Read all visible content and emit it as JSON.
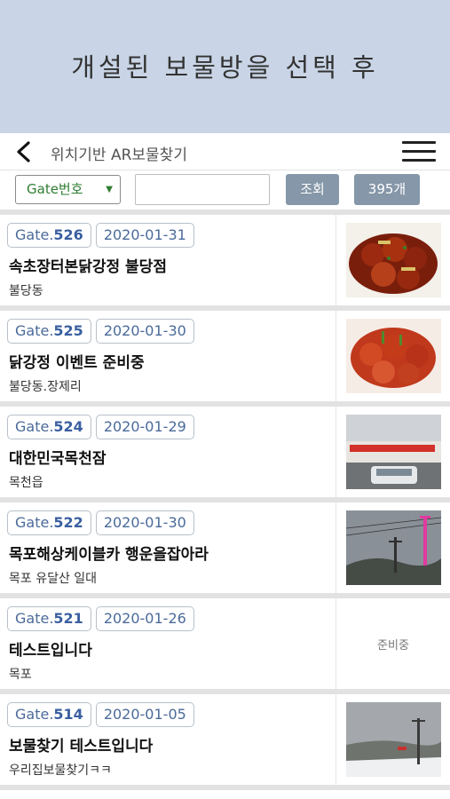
{
  "banner": {
    "text": "개설된 보물방을 선택 후"
  },
  "appbar": {
    "title": "위치기반 AR보물찾기"
  },
  "filter": {
    "select_value": "Gate번호",
    "search_value": "",
    "query_label": "조회",
    "count_label": "395개"
  },
  "items": [
    {
      "gate_prefix": "Gate.",
      "gate_num": "526",
      "date": "2020-01-31",
      "title": "속초장터본닭강정 불당점",
      "location": "불당동",
      "thumb": "food-photo",
      "thumb_text": ""
    },
    {
      "gate_prefix": "Gate.",
      "gate_num": "525",
      "date": "2020-01-30",
      "title": "닭강정 이벤트 준비중",
      "location": "불당동.장제리",
      "thumb": "food-photo",
      "thumb_text": ""
    },
    {
      "gate_prefix": "Gate.",
      "gate_num": "524",
      "date": "2020-01-29",
      "title": "대한민국목천잠",
      "location": "목천읍",
      "thumb": "building-photo",
      "thumb_text": ""
    },
    {
      "gate_prefix": "Gate.",
      "gate_num": "522",
      "date": "2020-01-30",
      "title": "목포해상케이블카 행운을잡아라",
      "location": "목포 유달산 일대",
      "thumb": "cablecar-photo",
      "thumb_text": ""
    },
    {
      "gate_prefix": "Gate.",
      "gate_num": "521",
      "date": "2020-01-26",
      "title": "테스트입니다",
      "location": "목포",
      "thumb": "none",
      "thumb_text": "준비중"
    },
    {
      "gate_prefix": "Gate.",
      "gate_num": "514",
      "date": "2020-01-05",
      "title": "보물찾기 테스트입니다",
      "location": "우리집보물찾기ㅋㅋ",
      "thumb": "snow-photo",
      "thumb_text": ""
    }
  ],
  "colors": {
    "banner_bg": "#c9d5e6",
    "button_bg": "#8597a8",
    "select_text": "#2e7d32",
    "gate_num": "#3a5fa0"
  }
}
